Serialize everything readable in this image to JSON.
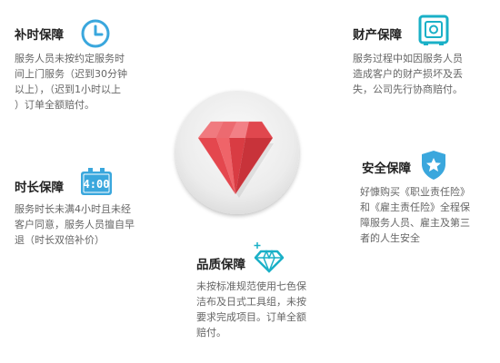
{
  "colors": {
    "icon_blue": "#3aa7dd",
    "icon_teal": "#1ab0c7",
    "ruby_red": "#e8464d",
    "disc_gray": "#e6e6e6"
  },
  "center": {
    "icon": "ruby-gem-icon"
  },
  "overtime": {
    "title": "补时保障",
    "icon": "clock-icon",
    "lines": [
      "服务人员未按约定服务时",
      "间上门服务（迟到30分钟",
      "以上），（迟到1小时以上",
      "）订单全额赔付。"
    ]
  },
  "property": {
    "title": "财产保障",
    "icon": "safe-icon",
    "lines": [
      "服务过程中如因服务人员",
      "造成客户的财产损坏及丢",
      "失，公司先行协商赔付。"
    ]
  },
  "duration": {
    "title": "时长保障",
    "icon": "digital-clock-icon",
    "clock_text": "4:00",
    "lines": [
      "服务时长未满4小时且未经",
      "客户同意，服务人员擅自早",
      "退（时长双倍补价）"
    ]
  },
  "safety": {
    "title": "安全保障",
    "icon": "shield-star-icon",
    "lines": [
      "好慷购买《职业责任险》",
      "和《雇主责任险》全程保",
      "障服务人员、雇主及第三",
      "者的人生安全"
    ]
  },
  "quality": {
    "title": "品质保障",
    "icon": "diamond-icon",
    "lines": [
      "未按标准规范使用七色保",
      "洁布及日式工具组，未按",
      "要求完成项目。订单全额",
      "赔付。"
    ]
  }
}
